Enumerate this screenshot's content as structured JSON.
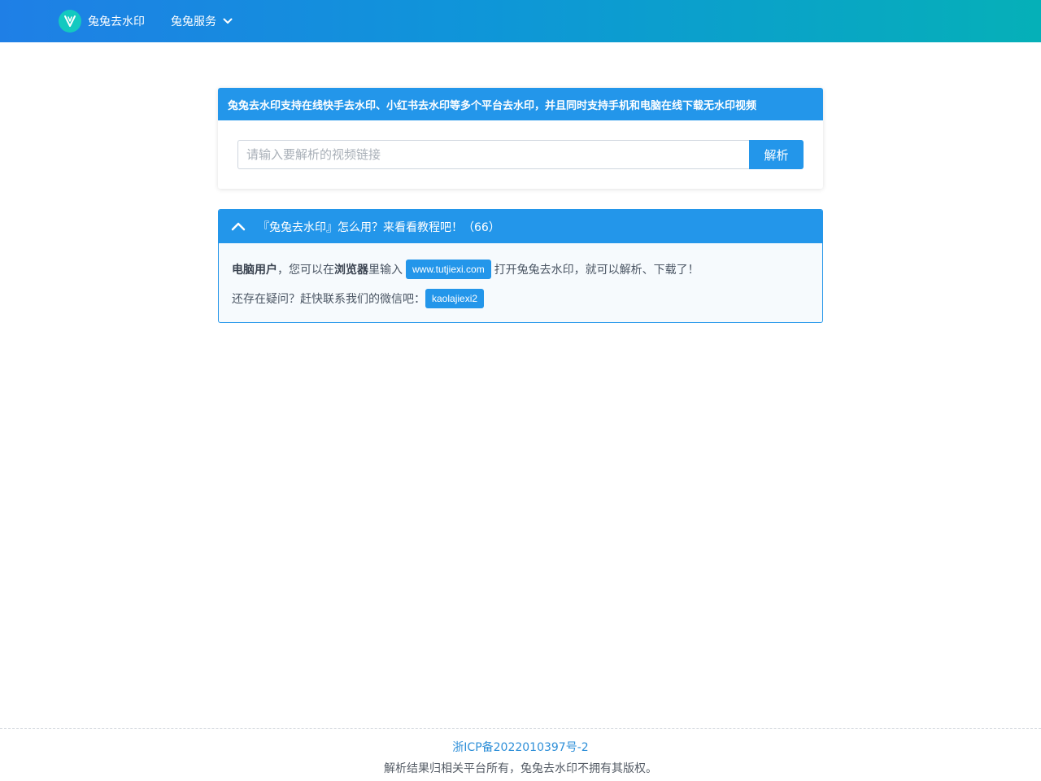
{
  "header": {
    "brand_name": "兔兔去水印",
    "logo_icon": "tutu-logo-icon",
    "nav_menu_label": "兔兔服务",
    "nav_menu_icon": "chevron-down-icon"
  },
  "parser": {
    "banner": "兔兔去水印支持在线快手去水印、小红书去水印等多个平台去水印，并且同时支持手机和电脑在线下载无水印视频",
    "input_placeholder": "请输入要解析的视频链接",
    "input_value": "",
    "button_label": "解析"
  },
  "tutorial": {
    "toggle_icon": "chevron-up-icon",
    "title": "『兔兔去水印』怎么用？来看看教程吧！（66）",
    "line1": {
      "bold1": "电脑用户",
      "text1": "，您可以在",
      "bold2": "浏览器",
      "text2": "里输入",
      "url_tag": "www.tutjiexi.com",
      "text3": "打开兔兔去水印，就可以解析、下载了！"
    },
    "line2": {
      "text": "还存在疑问？赶快联系我们的微信吧：",
      "wechat_tag": "kaolajiexi2"
    }
  },
  "footer": {
    "icp": "浙ICP备2022010397号-2",
    "copyright": "解析结果归相关平台所有，兔兔去水印不拥有其版权。"
  },
  "colors": {
    "accent": "#2396ea",
    "header_gradient_start": "#1f7fe6",
    "header_gradient_end": "#05b0b8",
    "logo": "#14c9c0",
    "link": "#2e8fd8"
  }
}
